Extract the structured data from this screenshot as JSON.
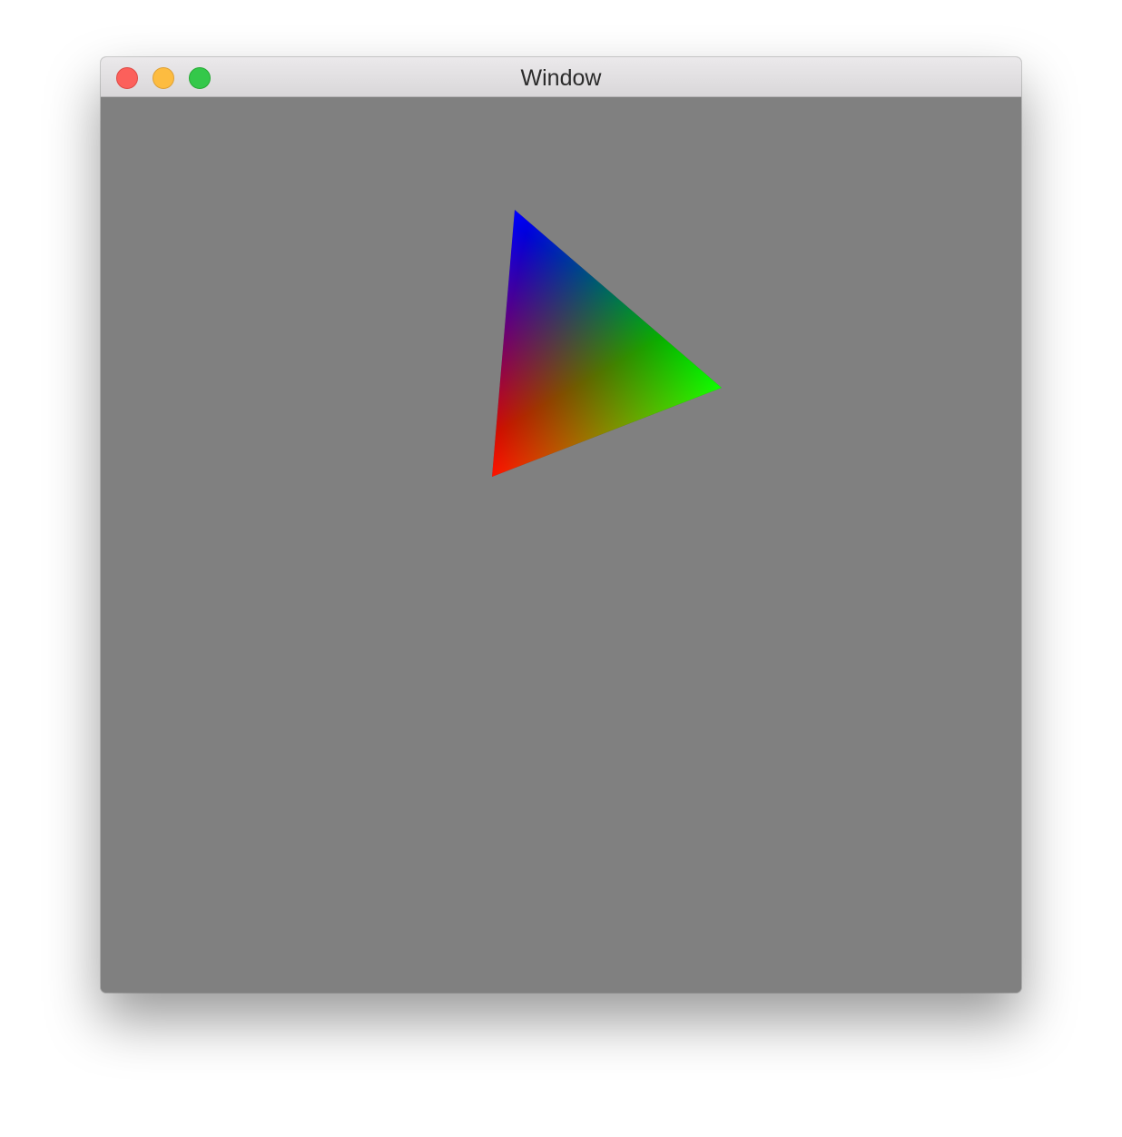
{
  "window": {
    "title": "Window"
  },
  "controls": {
    "close": "close-button",
    "minimize": "minimize-button",
    "zoom": "zoom-button"
  },
  "colors": {
    "background": "#808080",
    "vertex_top": "#0000ff",
    "vertex_right": "#00ff00",
    "vertex_bottom": "#ff0000"
  }
}
